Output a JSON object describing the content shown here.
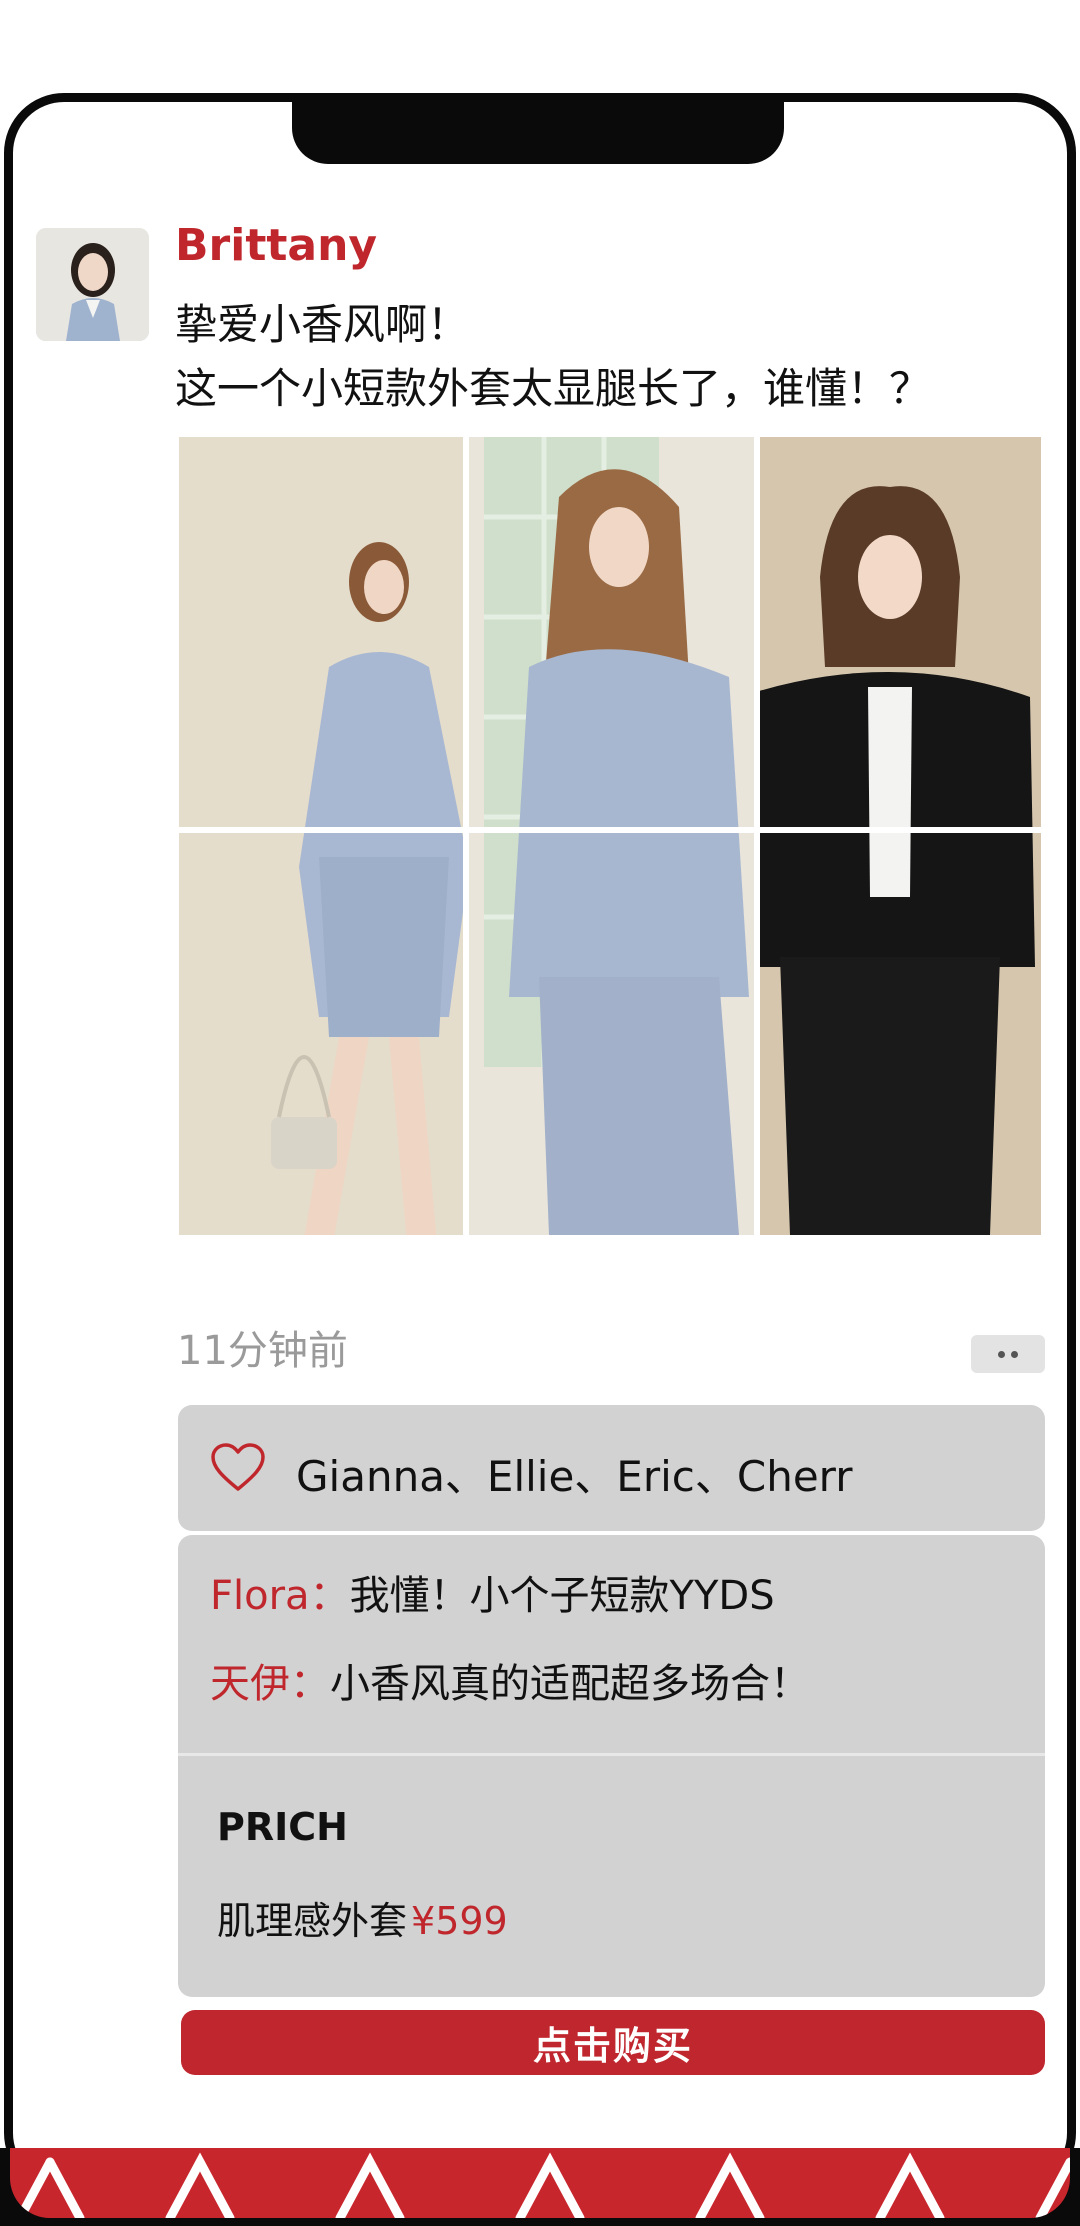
{
  "post": {
    "user_name": "Brittany",
    "text_line_1": "挚爱小香风啊！",
    "text_line_2": "这一个小短款外套太显腿长了，谁懂！？",
    "time": "11分钟前"
  },
  "likes": {
    "icon": "heart-outline-icon",
    "names": "Gianna、Ellie、Eric、Cherr"
  },
  "comments": [
    {
      "author": "Flora：",
      "text": "我懂！小个子短款YYDS"
    },
    {
      "author": "天伊：",
      "text": "小香风真的适配超多场合！"
    }
  ],
  "product": {
    "brand": "PRICH",
    "name": "肌理感外套",
    "price": "¥599"
  },
  "buy_button": {
    "label": "点击购买"
  },
  "colors": {
    "accent": "#c0272d",
    "box_bg": "#d2d2d2",
    "frame": "#0a0a0a"
  }
}
